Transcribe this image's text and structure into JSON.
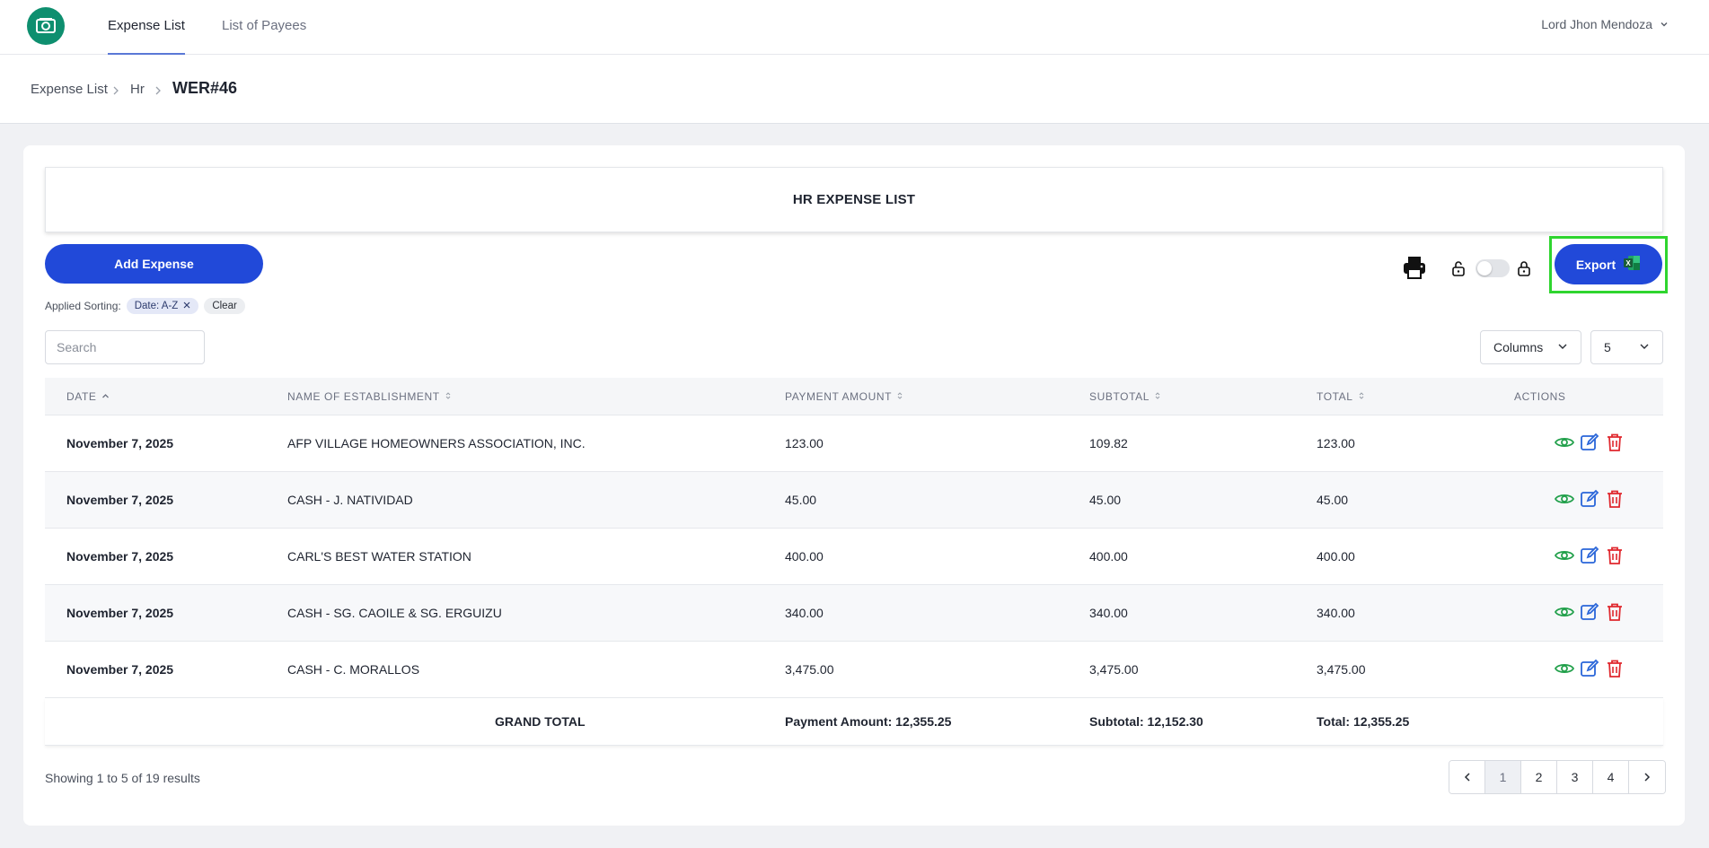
{
  "nav": {
    "tabs": [
      {
        "label": "Expense List",
        "active": true
      },
      {
        "label": "List of Payees",
        "active": false
      }
    ],
    "user_name": "Lord Jhon Mendoza"
  },
  "breadcrumb": {
    "items": [
      "Expense List",
      "Hr"
    ],
    "current": "WER#46"
  },
  "page": {
    "title": "HR EXPENSE LIST",
    "add_button": "Add Expense",
    "export_button": "Export",
    "sorting_label": "Applied Sorting:",
    "sort_chip": "Date: A-Z",
    "clear_label": "Clear",
    "search_placeholder": "Search",
    "columns_label": "Columns",
    "page_size": "5"
  },
  "table": {
    "headers": [
      "DATE",
      "NAME OF ESTABLISHMENT",
      "PAYMENT AMOUNT",
      "SUBTOTAL",
      "TOTAL",
      "ACTIONS"
    ],
    "rows": [
      {
        "date": "November 7, 2025",
        "name": "AFP VILLAGE HOMEOWNERS ASSOCIATION, INC.",
        "payment": "123.00",
        "subtotal": "109.82",
        "total": "123.00"
      },
      {
        "date": "November 7, 2025",
        "name": "CASH - J. NATIVIDAD",
        "payment": "45.00",
        "subtotal": "45.00",
        "total": "45.00"
      },
      {
        "date": "November 7, 2025",
        "name": "CARL'S BEST WATER STATION",
        "payment": "400.00",
        "subtotal": "400.00",
        "total": "400.00"
      },
      {
        "date": "November 7, 2025",
        "name": "CASH - SG. CAOILE & SG. ERGUIZU",
        "payment": "340.00",
        "subtotal": "340.00",
        "total": "340.00"
      },
      {
        "date": "November 7, 2025",
        "name": "CASH - C. MORALLOS",
        "payment": "3,475.00",
        "subtotal": "3,475.00",
        "total": "3,475.00"
      }
    ],
    "grand_total": {
      "label": "GRAND TOTAL",
      "payment": "Payment Amount: 12,355.25",
      "subtotal": "Subtotal: 12,152.30",
      "total": "Total: 12,355.25"
    }
  },
  "footer": {
    "showing_prefix": "Showing",
    "from": "1",
    "to_word": "to",
    "to": "5",
    "of_word": "of",
    "total": "19",
    "results_word": "results",
    "pages": [
      "1",
      "2",
      "3",
      "4"
    ],
    "current_page": "1"
  },
  "colors": {
    "primary": "#2149d9",
    "logo": "#0e8f6f",
    "highlight": "#2fd52f",
    "view": "#22a04b",
    "edit": "#2a66d9",
    "delete": "#e0282e"
  }
}
